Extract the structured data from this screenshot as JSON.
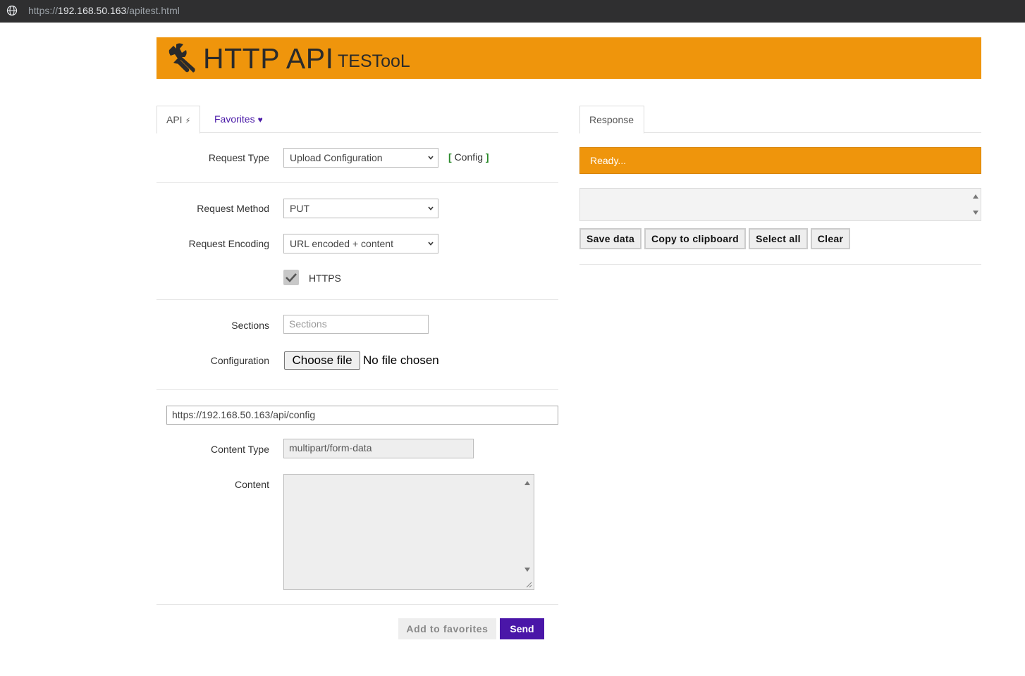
{
  "browser": {
    "url_scheme": "https://",
    "url_host": "192.168.50.163",
    "url_path": "/apitest.html"
  },
  "header": {
    "title": "HTTP API",
    "subtitle": "TESTooL",
    "icon": "wrench-icon",
    "color": "#ef950c"
  },
  "left_tabs": [
    {
      "label": "API",
      "icon": "bolt-icon",
      "active": true
    },
    {
      "label": "Favorites",
      "icon": "heart-icon",
      "active": false
    }
  ],
  "form": {
    "request_type": {
      "label": "Request Type",
      "value": "Upload Configuration"
    },
    "config_link": {
      "open": "[",
      "label": "Config",
      "close": "]"
    },
    "request_method": {
      "label": "Request Method",
      "value": "PUT"
    },
    "request_encoding": {
      "label": "Request Encoding",
      "value": "URL encoded + content"
    },
    "https": {
      "label": "HTTPS",
      "checked": true
    },
    "sections": {
      "label": "Sections",
      "placeholder": "Sections",
      "value": ""
    },
    "configuration": {
      "label": "Configuration",
      "button": "Choose file",
      "status": "No file chosen"
    },
    "url": "https://192.168.50.163/api/config",
    "content_type": {
      "label": "Content Type",
      "value": "multipart/form-data"
    },
    "content": {
      "label": "Content",
      "value": ""
    }
  },
  "actions": {
    "add_to_favorites": "Add to favorites",
    "send": "Send",
    "send_color": "#4a16a8"
  },
  "response": {
    "tab_label": "Response",
    "status": "Ready...",
    "buttons": {
      "save": "Save data",
      "copy": "Copy to clipboard",
      "select_all": "Select all",
      "clear": "Clear"
    }
  }
}
